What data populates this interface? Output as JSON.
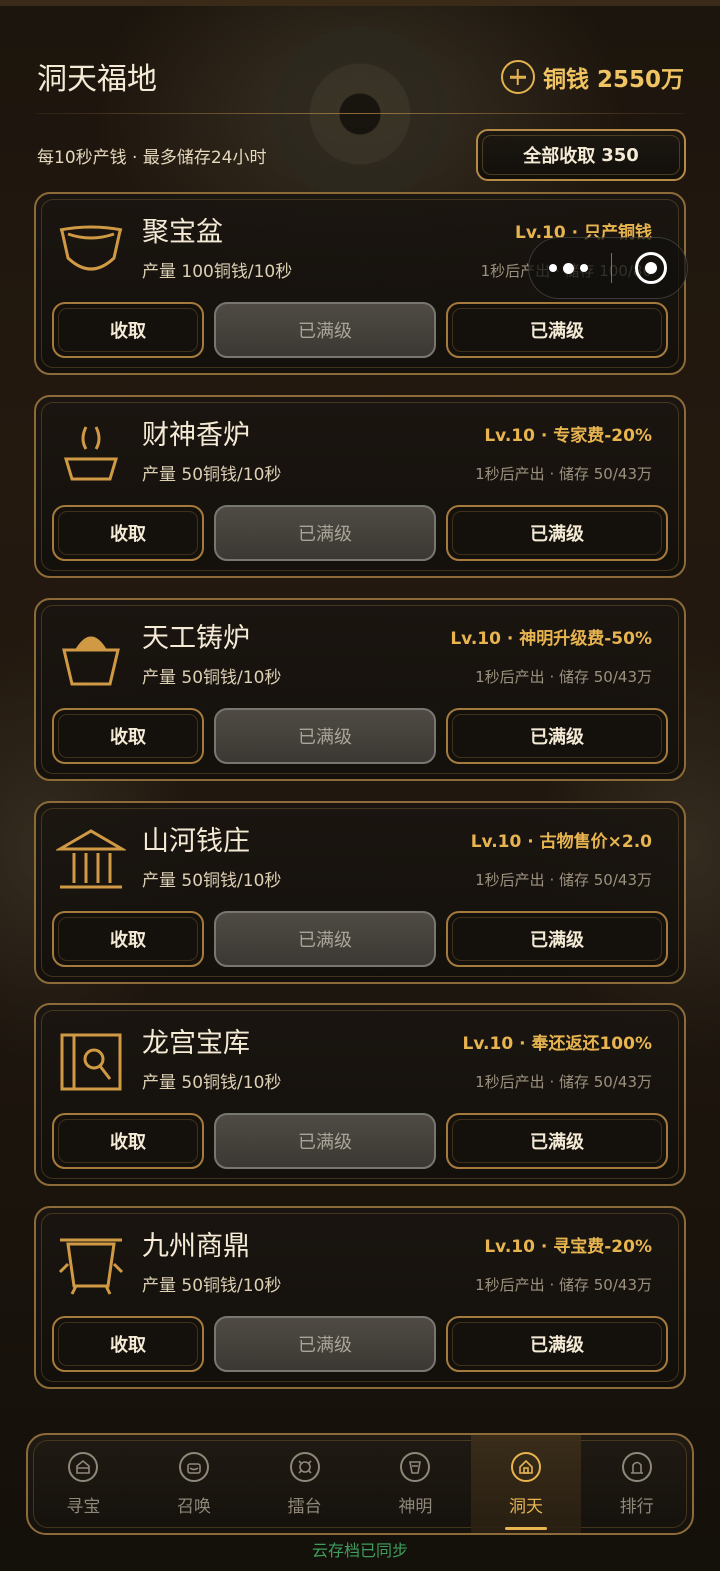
{
  "header": {
    "title": "洞天福地",
    "currency_label": "铜钱",
    "currency_value": "2550万",
    "info": "每10秒产钱 · 最多储存24小时",
    "collect_all_label": "全部收取",
    "collect_all_value": "350"
  },
  "buildings": [
    {
      "name": "聚宝盆",
      "icon": "bowl-icon",
      "tag": "Lv.10 · 只产铜钱",
      "production": "产量 100铜钱/10秒",
      "status": "1秒后产出 · 储存 100/86",
      "collect_label": "收取",
      "upgrade_label": "已满级",
      "max_label": "已满级"
    },
    {
      "name": "财神香炉",
      "icon": "incense-burner-icon",
      "tag": "Lv.10 · 专家费-20%",
      "production": "产量 50铜钱/10秒",
      "status": "1秒后产出 · 储存 50/43万",
      "collect_label": "收取",
      "upgrade_label": "已满级",
      "max_label": "已满级"
    },
    {
      "name": "天工铸炉",
      "icon": "forge-icon",
      "tag": "Lv.10 · 神明升级费-50%",
      "production": "产量 50铜钱/10秒",
      "status": "1秒后产出 · 储存 50/43万",
      "collect_label": "收取",
      "upgrade_label": "已满级",
      "max_label": "已满级"
    },
    {
      "name": "山河钱庄",
      "icon": "bank-icon",
      "tag": "Lv.10 · 古物售价×2.0",
      "production": "产量 50铜钱/10秒",
      "status": "1秒后产出 · 储存 50/43万",
      "collect_label": "收取",
      "upgrade_label": "已满级",
      "max_label": "已满级"
    },
    {
      "name": "龙宫宝库",
      "icon": "vault-icon",
      "tag": "Lv.10 · 奉还返还100%",
      "production": "产量 50铜钱/10秒",
      "status": "1秒后产出 · 储存 50/43万",
      "collect_label": "收取",
      "upgrade_label": "已满级",
      "max_label": "已满级"
    },
    {
      "name": "九州商鼎",
      "icon": "cauldron-icon",
      "tag": "Lv.10 · 寻宝费-20%",
      "production": "产量 50铜钱/10秒",
      "status": "1秒后产出 · 储存 50/43万",
      "collect_label": "收取",
      "upgrade_label": "已满级",
      "max_label": "已满级"
    }
  ],
  "nav": [
    {
      "label": "寻宝",
      "icon": "treasure-hunt-icon",
      "active": false
    },
    {
      "label": "召唤",
      "icon": "summon-icon",
      "active": false
    },
    {
      "label": "擂台",
      "icon": "arena-icon",
      "active": false
    },
    {
      "label": "神明",
      "icon": "deity-icon",
      "active": false
    },
    {
      "label": "洞天",
      "icon": "cave-home-icon",
      "active": true
    },
    {
      "label": "排行",
      "icon": "ranking-icon",
      "active": false
    }
  ],
  "sync_status": "云存档已同步",
  "colors": {
    "accent": "#e7b450",
    "border": "#8c6b39",
    "sync": "#3e9e5d"
  }
}
